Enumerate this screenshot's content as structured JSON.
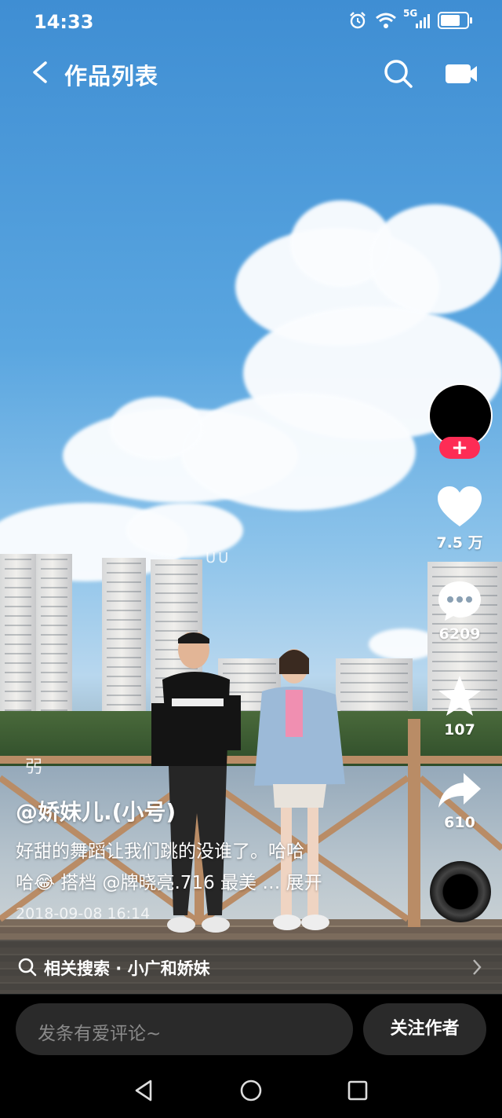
{
  "status_bar": {
    "time": "14:33",
    "network": "5G"
  },
  "header": {
    "title": "作品列表",
    "back_icon": "chevron-left-icon",
    "search_icon": "search-icon",
    "camera_icon": "camera-icon"
  },
  "video": {
    "overlay_text": "UU"
  },
  "actions": {
    "follow_plus": "+",
    "likes": "7.5 万",
    "comments": "6209",
    "favorites": "107",
    "shares": "610"
  },
  "caption": {
    "music_note": "弜",
    "author": "@娇妹儿.(小号)",
    "description_line1": "好甜的舞蹈让我们跳的没谁了。哈哈",
    "description_line2": "哈😂 搭档 @牌晓亮.716 最美 … ",
    "expand": "展开",
    "date": "2018-09-08 16:14"
  },
  "related_search": {
    "label": "相关搜索 · 小广和娇妹"
  },
  "comment_bar": {
    "placeholder": "发条有爱评论~",
    "follow_button": "关注作者"
  },
  "colors": {
    "accent": "#fe2c55",
    "bar": "#2a2a2a"
  }
}
